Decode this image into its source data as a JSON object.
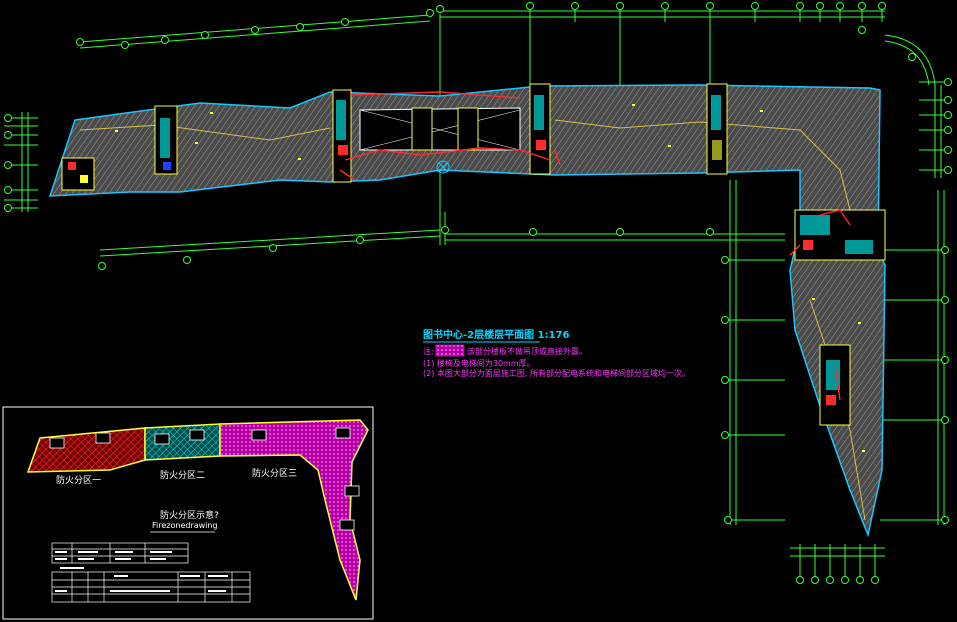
{
  "drawing": {
    "title": "图书中心-2层楼层平面图 1:176",
    "notes": [
      "注:",
      "该部分楼板不做吊顶或直接外露。",
      "(1) 楼梯及电梯间为30mm厚。",
      "(2) 本图大部分为面层施工图, 所有部分配电系统和电梯间部分区域均一次。"
    ],
    "legend": {
      "zone1": "防火分区一",
      "zone2": "防火分区二",
      "zone3": "防火分区三",
      "diagram_title": "防火分区示意?",
      "diagram_subtitle": "Firezonedrawing"
    }
  },
  "colors": {
    "background": "#000000",
    "outline": "#19c6ff",
    "grid": "#35ff35",
    "hatch": "#a8a8a8",
    "core": "#ffff33",
    "pipe": "#ff2a2a",
    "zone1": "#ff2020",
    "zone2": "#00c8c8",
    "zone3": "#ff22dd",
    "zone_border": "#ffff33",
    "text_blue": "#00d7ff",
    "text_magenta": "#ff33ff"
  }
}
